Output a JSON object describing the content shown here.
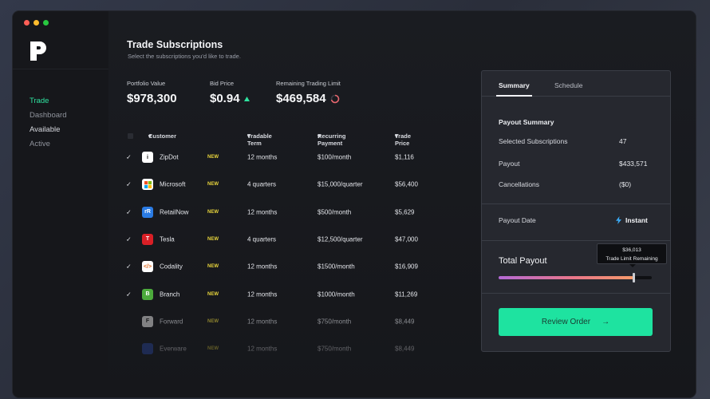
{
  "sidebar": {
    "nav": [
      "Trade",
      "Dashboard",
      "Available",
      "Active"
    ]
  },
  "page": {
    "title": "Trade Subscriptions",
    "subtitle": "Select the subscriptions you'd like to trade."
  },
  "stats": {
    "portfolio_label": "Portfolio Value",
    "portfolio_value": "$978,300",
    "bid_label": "Bid Price",
    "bid_value": "$0.94",
    "limit_label": "Remaining Trading Limit",
    "limit_value": "$469,584"
  },
  "table": {
    "headers": [
      "Customer",
      "Tradable Term",
      "Recurring Payment",
      "Trade Price"
    ],
    "rows": [
      {
        "name": "ZipDot",
        "badge": "NEW",
        "term": "12 months",
        "payment": "$100/month",
        "price": "$1,116",
        "checked": "✓",
        "logo_text": "i",
        "logo_bg": "#ffffff",
        "logo_fg": "#111111"
      },
      {
        "name": "Microsoft",
        "badge": "NEW",
        "term": "4 quarters",
        "payment": "$15,000/quarter",
        "price": "$56,400",
        "checked": "✓",
        "logo_text": "",
        "logo_bg": "#ffffff",
        "logo_fg": "#111111"
      },
      {
        "name": "RetailNow",
        "badge": "NEW",
        "term": "12 months",
        "payment": "$500/month",
        "price": "$5,629",
        "checked": "✓",
        "logo_text": "rR",
        "logo_bg": "#2a7be4",
        "logo_fg": "#ffffff"
      },
      {
        "name": "Tesla",
        "badge": "NEW",
        "term": "4 quarters",
        "payment": "$12,500/quarter",
        "price": "$47,000",
        "checked": "✓",
        "logo_text": "T",
        "logo_bg": "#d91f26",
        "logo_fg": "#ffffff"
      },
      {
        "name": "Codality",
        "badge": "NEW",
        "term": "12 months",
        "payment": "$1500/month",
        "price": "$16,909",
        "checked": "✓",
        "logo_text": "</>",
        "logo_bg": "#ffffff",
        "logo_fg": "#e26a1e"
      },
      {
        "name": "Branch",
        "badge": "NEW",
        "term": "12 months",
        "payment": "$1000/month",
        "price": "$11,269",
        "checked": "✓",
        "logo_text": "B",
        "logo_bg": "#4caa3c",
        "logo_fg": "#ffffff"
      },
      {
        "name": "Forward",
        "badge": "NEW",
        "term": "12 months",
        "payment": "$750/month",
        "price": "$8,449",
        "checked": "",
        "logo_text": "F",
        "logo_bg": "#d8d8d8",
        "logo_fg": "#222222"
      },
      {
        "name": "Everware",
        "badge": "NEW",
        "term": "12 months",
        "payment": "$750/month",
        "price": "$8,449",
        "checked": "",
        "logo_text": "",
        "logo_bg": "#2c4fb8",
        "logo_fg": "#ffffff"
      }
    ]
  },
  "panel": {
    "tabs": [
      "Summary",
      "Schedule"
    ],
    "section_title": "Payout Summary",
    "selected_label": "Selected Subscriptions",
    "selected_value": "47",
    "payout_label": "Payout",
    "payout_value": "$433,571",
    "cancellations_label": "Cancellations",
    "cancellations_value": "($0)",
    "payout_date_label": "Payout Date",
    "payout_date_value": "Instant",
    "total_label": "Total Payout",
    "tooltip_amount": "$36,013",
    "tooltip_text": "Trade Limit Remaining",
    "progress_fraction": 0.88,
    "review_label": "Review Order"
  },
  "colors": {
    "accent": "#2fe3a0",
    "badge": "#e7d43c",
    "button": "#1ee3a0"
  },
  "icons": [
    "logo-icon",
    "check-icon",
    "sort-caret-icon",
    "trend-up-icon",
    "spinner-icon",
    "lightning-icon",
    "arrow-right-icon"
  ]
}
